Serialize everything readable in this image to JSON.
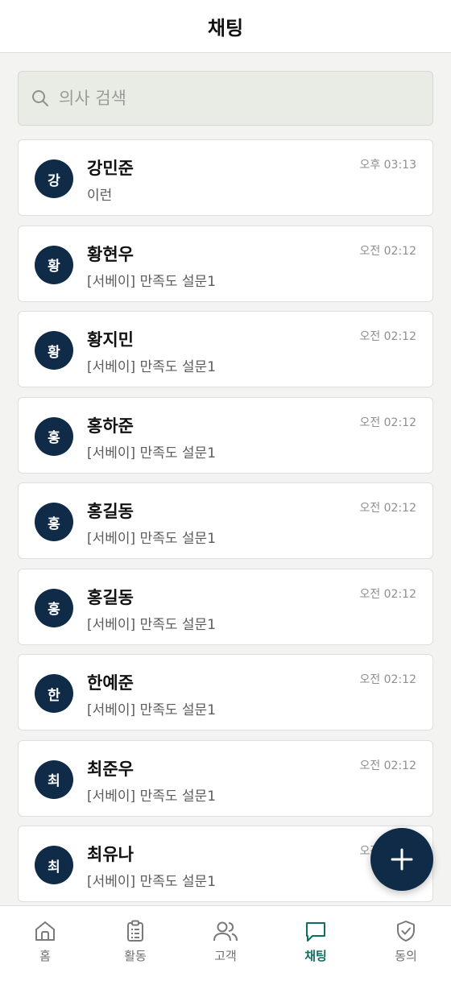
{
  "header": {
    "title": "채팅"
  },
  "search": {
    "placeholder": "의사 검색",
    "value": ""
  },
  "chats": [
    {
      "avatar": "강",
      "name": "강민준",
      "preview": "이런",
      "time": "오후 03:13"
    },
    {
      "avatar": "황",
      "name": "황현우",
      "preview": "[서베이] 만족도 설문1",
      "time": "오전 02:12"
    },
    {
      "avatar": "황",
      "name": "황지민",
      "preview": "[서베이] 만족도 설문1",
      "time": "오전 02:12"
    },
    {
      "avatar": "홍",
      "name": "홍하준",
      "preview": "[서베이] 만족도 설문1",
      "time": "오전 02:12"
    },
    {
      "avatar": "홍",
      "name": "홍길동",
      "preview": "[서베이] 만족도 설문1",
      "time": "오전 02:12"
    },
    {
      "avatar": "홍",
      "name": "홍길동",
      "preview": "[서베이] 만족도 설문1",
      "time": "오전 02:12"
    },
    {
      "avatar": "한",
      "name": "한예준",
      "preview": "[서베이] 만족도 설문1",
      "time": "오전 02:12"
    },
    {
      "avatar": "최",
      "name": "최준우",
      "preview": "[서베이] 만족도 설문1",
      "time": "오전 02:12"
    },
    {
      "avatar": "최",
      "name": "최유나",
      "preview": "[서베이] 만족도 설문1",
      "time": "오전 02:12"
    }
  ],
  "fab": {
    "icon": "plus-icon"
  },
  "bottom_nav": [
    {
      "label": "홈",
      "icon": "home-icon",
      "active": false
    },
    {
      "label": "활동",
      "icon": "clipboard-icon",
      "active": false
    },
    {
      "label": "고객",
      "icon": "users-icon",
      "active": false
    },
    {
      "label": "채팅",
      "icon": "chat-icon",
      "active": true
    },
    {
      "label": "동의",
      "icon": "shield-check-icon",
      "active": false
    }
  ],
  "colors": {
    "primary": "#0f2b47",
    "active": "#0e6e62",
    "background": "#f3f3f1",
    "search_bg": "#e9ebe5"
  }
}
